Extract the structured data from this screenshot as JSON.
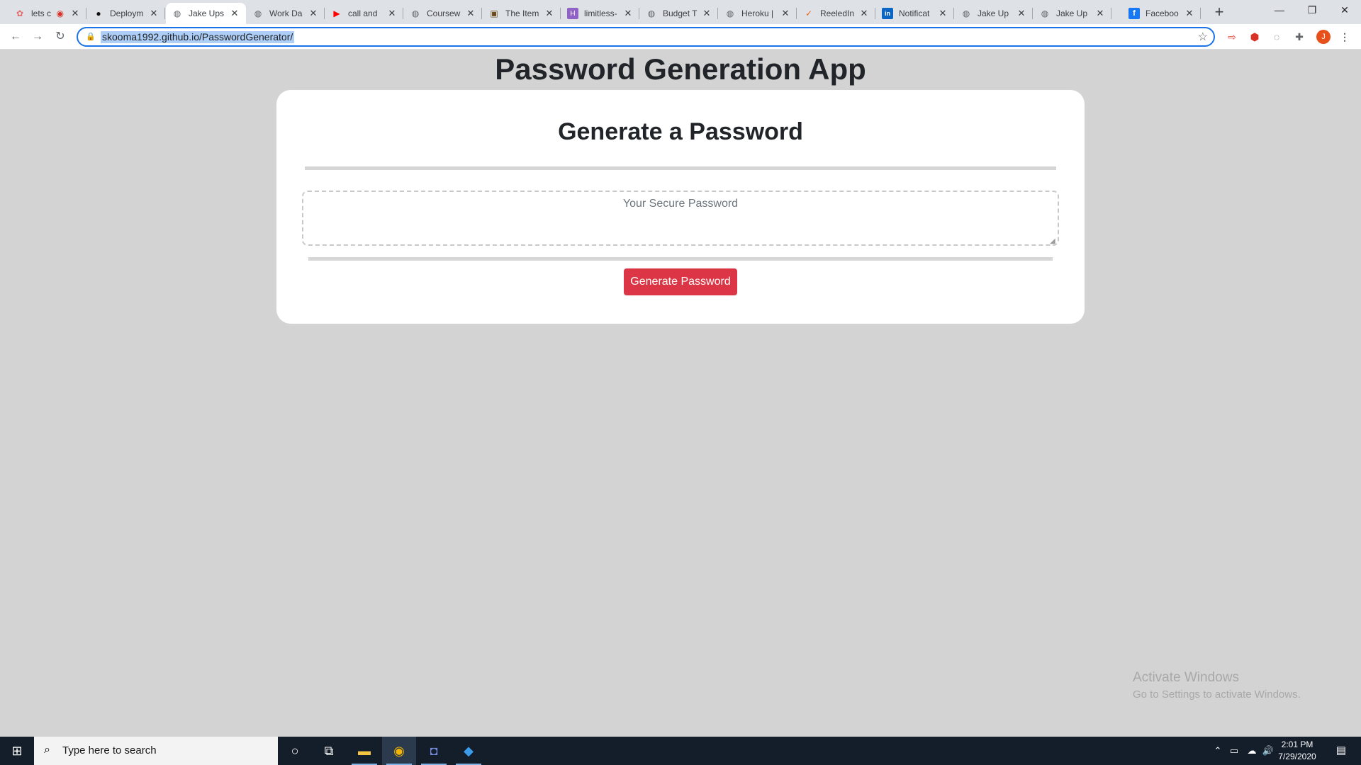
{
  "browser": {
    "tabs": [
      {
        "label": "lets c",
        "favicon": "rose-icon",
        "active": false
      },
      {
        "label": "Deploym",
        "favicon": "github-icon",
        "active": false
      },
      {
        "label": "Jake Ups",
        "favicon": "globe-icon",
        "active": true
      },
      {
        "label": "Work Da",
        "favicon": "globe-icon",
        "active": false
      },
      {
        "label": "call and",
        "favicon": "youtube-icon",
        "active": false
      },
      {
        "label": "Coursew",
        "favicon": "globe-icon",
        "active": false
      },
      {
        "label": "The Item",
        "favicon": "chest-icon",
        "active": false
      },
      {
        "label": "limitless-",
        "favicon": "h-icon",
        "active": false
      },
      {
        "label": "Budget T",
        "favicon": "globe-icon",
        "active": false
      },
      {
        "label": "Heroku |",
        "favicon": "globe-icon",
        "active": false
      },
      {
        "label": "ReeledIn",
        "favicon": "swoosh-icon",
        "active": false
      },
      {
        "label": "Notificat",
        "favicon": "linkedin-icon",
        "active": false
      },
      {
        "label": "Jake Up",
        "favicon": "globe-icon",
        "active": false
      },
      {
        "label": "Jake Up",
        "favicon": "globe-icon",
        "active": false
      },
      {
        "label": "Faceboo",
        "favicon": "facebook-icon",
        "active": false
      }
    ],
    "url": "skooma1992.github.io/PasswordGenerator/",
    "profile_initial": "J"
  },
  "page": {
    "app_title": "Password Generation App",
    "card_title": "Generate a Password",
    "password_placeholder": "Your Secure Password",
    "password_value": "",
    "generate_button": "Generate Password",
    "accent_color": "#dc3545",
    "background_color": "#d3d3d3"
  },
  "watermark": {
    "title": "Activate Windows",
    "subtitle": "Go to Settings to activate Windows."
  },
  "taskbar": {
    "search_placeholder": "Type here to search",
    "time": "2:01 PM",
    "date": "7/29/2020"
  }
}
